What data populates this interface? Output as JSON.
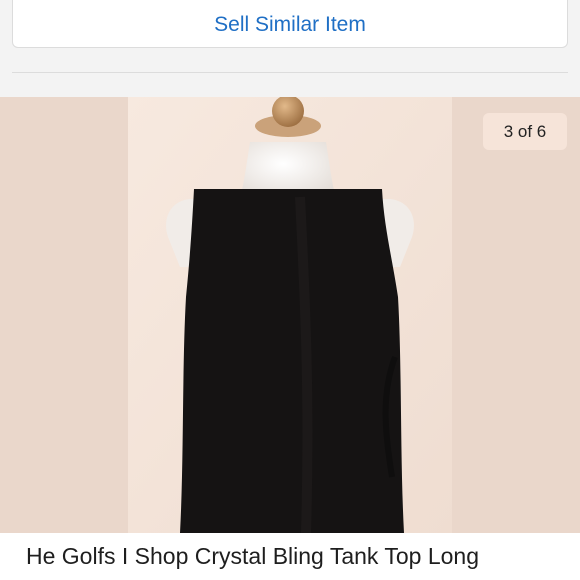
{
  "actions": {
    "sell_similar_label": "Sell Similar Item"
  },
  "gallery": {
    "counter_text": "3 of 6",
    "image_subject": "black sleeveless tank top on dress form"
  },
  "listing": {
    "title": "He Golfs I Shop Crystal Bling Tank Top Long"
  },
  "colors": {
    "link_blue": "#1f6fc5",
    "photo_bg": "#ead7cb",
    "garment": "#151313"
  }
}
